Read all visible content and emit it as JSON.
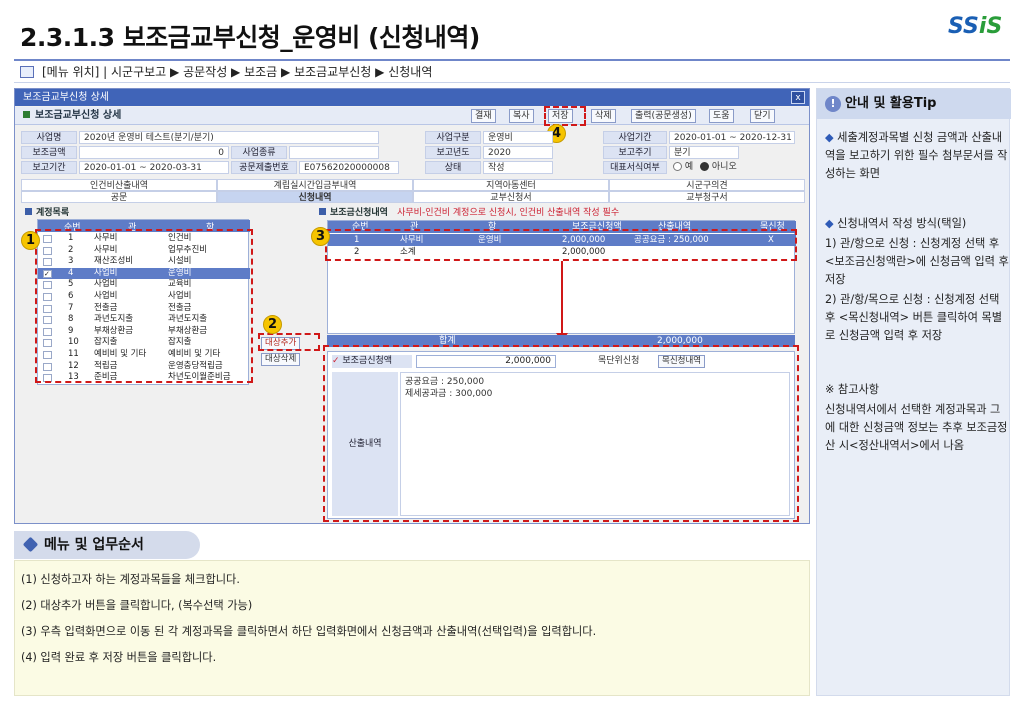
{
  "title": "2.3.1.3 보조금교부신청_운영비 (신청내역)",
  "logo": {
    "prefix": "SS",
    "suffix": "iS"
  },
  "breadcrumb": "[메뉴 위치] | 시군구보고 ▶ 공문작성 ▶ 보조금 ▶ 보조금교부신청 ▶ 신청내역",
  "window": {
    "title": "보조금교부신청 상세",
    "header": "보조금교부신청 상세",
    "close": "x",
    "toolbar": {
      "approve": "결재",
      "copy": "복사",
      "save": "저장",
      "delete": "삭제",
      "print": "출력(공문생성)",
      "help": "도움",
      "close": "닫기"
    },
    "form": {
      "biz_name_label": "사업명",
      "biz_name": "2020년 운영비 테스트(분기/분기)",
      "biz_type_label": "사업구분",
      "biz_type": "운영비",
      "biz_period_label": "사업기간",
      "biz_period": "2020-01-01 ~ 2020-12-31",
      "sub_amount_label": "보조금액",
      "sub_amount": "0",
      "biz_kind_label": "사업종류",
      "biz_kind": "",
      "report_year_label": "보고년도",
      "report_year": "2020",
      "report_cycle_label": "보고주기",
      "report_cycle": "분기",
      "report_period_label": "보고기간",
      "report_period": "2020-01-01 ~ 2020-03-31",
      "doc_no_label": "공문제출번호",
      "doc_no": "E07562020000008",
      "state_label": "상태",
      "state": "작성",
      "rep_doc_label": "대표서식여부",
      "rep_yes": "예",
      "rep_no": "아니오"
    },
    "tabs_row1": [
      "인건비산출내역",
      "계립실시간입금부내역",
      "지역아동센터",
      "시군구의견"
    ],
    "tabs_row2": [
      "공문",
      "신청내역",
      "교부신청서",
      "교부청구서"
    ],
    "left_section": "계정목록",
    "right_section": "보조금신청내역",
    "right_warning": "사무비-인건비 계정으로 신청시, 인건비 산출내역 작성 필수",
    "account_grid": {
      "headers": [
        "순번",
        "관",
        "항"
      ],
      "rows": [
        [
          "1",
          "사무비",
          "인건비"
        ],
        [
          "2",
          "사무비",
          "업무추진비"
        ],
        [
          "3",
          "재산조성비",
          "시설비"
        ],
        [
          "4",
          "사업비",
          "운영비"
        ],
        [
          "5",
          "사업비",
          "교육비"
        ],
        [
          "6",
          "사업비",
          "사업비"
        ],
        [
          "7",
          "전출금",
          "전출금"
        ],
        [
          "8",
          "과년도지출",
          "과년도지출"
        ],
        [
          "9",
          "부채상환금",
          "부채상환금"
        ],
        [
          "10",
          "잡지출",
          "잡지출"
        ],
        [
          "11",
          "예비비 및 기타",
          "예비비 및 기타"
        ],
        [
          "12",
          "적립금",
          "운영충당적립금"
        ],
        [
          "13",
          "준비금",
          "차년도이월준비금"
        ]
      ]
    },
    "add_button": "대상추가",
    "del_button": "대상삭제",
    "right_grid": {
      "headers": [
        "순번",
        "관",
        "항",
        "보조금신청액",
        "산출내역",
        "목신청"
      ],
      "rows": [
        [
          "1",
          "사무비",
          "운영비",
          "2,000,000",
          "공공요금 : 250,000",
          "X"
        ],
        [
          "2",
          "소계",
          "",
          "2,000,000",
          "",
          ""
        ]
      ],
      "total_label": "합계",
      "total_value": "2,000,000"
    },
    "input": {
      "amount_label": "보조금신청액",
      "amount": "2,000,000",
      "detail_cancel": "목단위신청",
      "detail_list": "목신청내역",
      "calc_label": "산출내역",
      "calc_lines": [
        "공공요금 : 250,000",
        "제세공과금 : 300,000"
      ]
    },
    "markers": [
      "1",
      "2",
      "3",
      "4"
    ]
  },
  "tip": {
    "heading": "안내 및 활용Tip",
    "intro": "세출계정과목별 신청 금액과 산출내역을 보고하기 위한 필수 첨부문서를 작성하는 화면",
    "method_title": "신청내역서 작성 방식(택일)",
    "method_1": "1) 관/항으로 신청 : 신청계정 선택 후 <보조금신청액란>에 신청금액 입력 후 저장",
    "method_2": "2) 관/항/목으로 신청 : 신청계정 선택 후 <목신청내역> 버튼 클릭하여 목별로 신청금액 입력 후 저장",
    "note_title": "※ 참고사항",
    "note": "신청내역서에서 선택한 계정과목과 그에 대한 신청금액 정보는 추후 보조금정산 시<정산내역서>에서 나옴"
  },
  "menu": {
    "heading": "메뉴 및 업무순서",
    "steps": [
      "(1) 신청하고자 하는 계정과목들을 체크합니다.",
      "(2) 대상추가 버튼을 클릭합니다, (복수선택 가능)",
      "(3) 우측 입력화면으로 이동 된 각 계정과목을 클릭하면서 하단 입력화면에서 신청금액과 산출내역(선택입력)을 입력합니다.",
      "(4) 입력 완료 후 저장 버튼을 클릭합니다."
    ]
  },
  "colors": {
    "accent": "#4064b8",
    "marker": "#f6c400",
    "highlight_box": "#d01818",
    "menu_bg": "#fbfbe4",
    "tip_bg": "#e9eef7"
  }
}
